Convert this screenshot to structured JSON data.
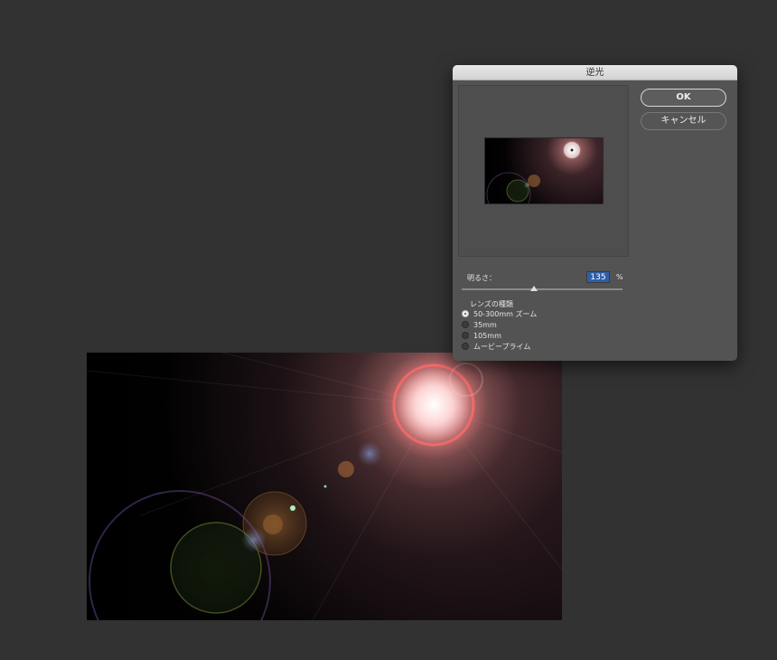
{
  "dialog": {
    "title": "逆光",
    "ok_label": "OK",
    "cancel_label": "キャンセル",
    "brightness_label": "明るさ：",
    "brightness_value": "135",
    "brightness_unit": "%",
    "brightness_slider_fraction": 0.45,
    "lens_group_label": "レンズの種類",
    "lens_options": [
      {
        "label": "50-300mm ズーム",
        "checked": true
      },
      {
        "label": "35mm",
        "checked": false
      },
      {
        "label": "105mm",
        "checked": false
      },
      {
        "label": "ムービープライム",
        "checked": false
      }
    ]
  },
  "colors": {
    "workspace": "#323232",
    "dialog_bg": "#535353",
    "input_highlight": "#2e5fa9"
  }
}
